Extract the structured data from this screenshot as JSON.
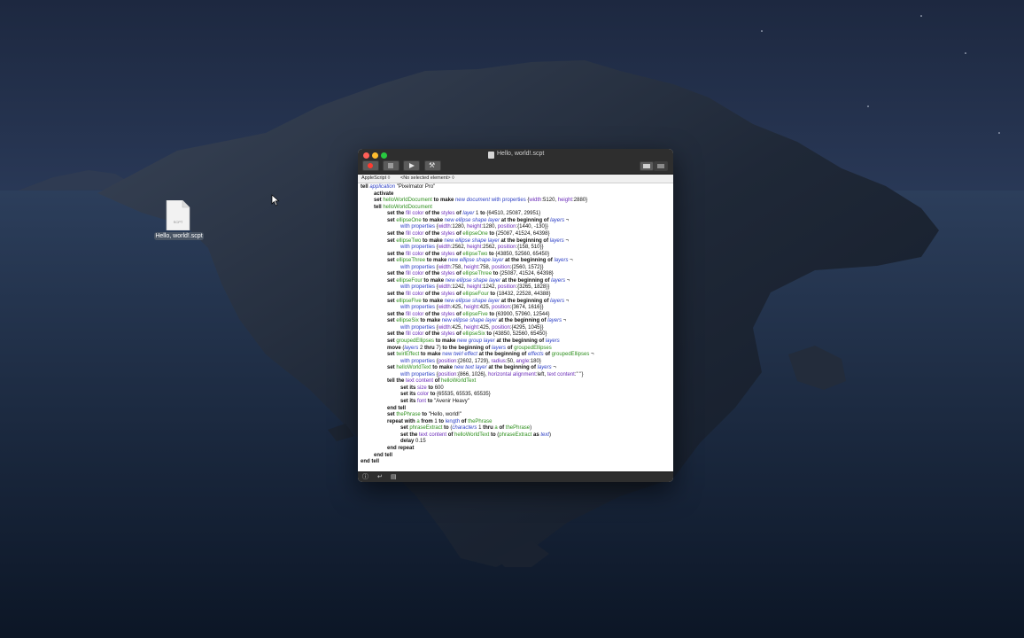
{
  "desktop": {
    "file_label": "Hello, world!.scpt",
    "file_kind": "SCPT"
  },
  "window": {
    "title": "Hello, world!.scpt",
    "language": "AppleScript ◊",
    "element_selector": "<No selected element> ◊",
    "toolbar": {
      "record": "record-icon",
      "stop": "stop-icon",
      "run": "play-icon",
      "compile": "hammer-icon"
    },
    "status_icons": [
      "ⓘ",
      "↵",
      "▤"
    ]
  },
  "colors": {
    "keyword": "#111111",
    "application_class": "#2b3ec4",
    "property": "#6a2bb8",
    "variable": "#2e8f1d",
    "record_button": "#ff3b30"
  },
  "code": [
    {
      "indent": 0,
      "tokens": [
        [
          "kw",
          "tell "
        ],
        [
          "app",
          "application "
        ],
        [
          "txt",
          "\"Pixelmator Pro\""
        ]
      ]
    },
    {
      "indent": 1,
      "tokens": [
        [
          "kw",
          "activate"
        ]
      ]
    },
    {
      "indent": 1,
      "tokens": [
        [
          "kw",
          "set "
        ],
        [
          "var",
          "helloWorldDocument"
        ],
        [
          "kw",
          " to "
        ],
        [
          "kw",
          "make "
        ],
        [
          "ver",
          "new "
        ],
        [
          "cls",
          "document "
        ],
        [
          "ver",
          "with properties "
        ],
        [
          "txt",
          "{"
        ],
        [
          "prop",
          "width"
        ],
        [
          "txt",
          ":5120, "
        ],
        [
          "prop",
          "height"
        ],
        [
          "txt",
          ":2880}"
        ]
      ]
    },
    {
      "indent": 1,
      "tokens": [
        [
          "kw",
          "tell "
        ],
        [
          "var",
          "helloWorldDocument"
        ]
      ]
    },
    {
      "indent": 2,
      "tokens": [
        [
          "kw",
          "set the "
        ],
        [
          "prop",
          "fill color"
        ],
        [
          "kw",
          " of the "
        ],
        [
          "prop",
          "styles"
        ],
        [
          "kw",
          " of "
        ],
        [
          "cls",
          "layer "
        ],
        [
          "txt",
          "1 "
        ],
        [
          "kw",
          "to "
        ],
        [
          "txt",
          "{64510, 25087, 29951}"
        ]
      ]
    },
    {
      "indent": 2,
      "tokens": [
        [
          "kw",
          "set "
        ],
        [
          "var",
          "ellipseOne"
        ],
        [
          "kw",
          " to "
        ],
        [
          "kw",
          "make "
        ],
        [
          "ver",
          "new "
        ],
        [
          "cls",
          "ellipse shape layer "
        ],
        [
          "kw",
          "at the beginning of "
        ],
        [
          "cls",
          "layers "
        ],
        [
          "txt",
          "¬"
        ]
      ]
    },
    {
      "indent": 3,
      "tokens": [
        [
          "ver",
          "with properties "
        ],
        [
          "txt",
          "{"
        ],
        [
          "prop",
          "width"
        ],
        [
          "txt",
          ":1280, "
        ],
        [
          "prop",
          "height"
        ],
        [
          "txt",
          ":1280, "
        ],
        [
          "prop",
          "position"
        ],
        [
          "txt",
          ":{1440, -130}}"
        ]
      ]
    },
    {
      "indent": 2,
      "tokens": [
        [
          "kw",
          "set the "
        ],
        [
          "prop",
          "fill color"
        ],
        [
          "kw",
          " of the "
        ],
        [
          "prop",
          "styles"
        ],
        [
          "kw",
          " of "
        ],
        [
          "var",
          "ellipseOne"
        ],
        [
          "kw",
          " to "
        ],
        [
          "txt",
          "{25087, 41524, 64398}"
        ]
      ]
    },
    {
      "indent": 2,
      "tokens": [
        [
          "kw",
          "set "
        ],
        [
          "var",
          "ellipseTwo"
        ],
        [
          "kw",
          " to "
        ],
        [
          "kw",
          "make "
        ],
        [
          "ver",
          "new "
        ],
        [
          "cls",
          "ellipse shape layer "
        ],
        [
          "kw",
          "at the beginning of "
        ],
        [
          "cls",
          "layers "
        ],
        [
          "txt",
          "¬"
        ]
      ]
    },
    {
      "indent": 3,
      "tokens": [
        [
          "ver",
          "with properties "
        ],
        [
          "txt",
          "{"
        ],
        [
          "prop",
          "width"
        ],
        [
          "txt",
          ":2562, "
        ],
        [
          "prop",
          "height"
        ],
        [
          "txt",
          ":2562, "
        ],
        [
          "prop",
          "position"
        ],
        [
          "txt",
          ":{158, 510}}"
        ]
      ]
    },
    {
      "indent": 2,
      "tokens": [
        [
          "kw",
          "set the "
        ],
        [
          "prop",
          "fill color"
        ],
        [
          "kw",
          " of the "
        ],
        [
          "prop",
          "styles"
        ],
        [
          "kw",
          " of "
        ],
        [
          "var",
          "ellipseTwo"
        ],
        [
          "kw",
          " to "
        ],
        [
          "txt",
          "{43850, 52560, 65450}"
        ]
      ]
    },
    {
      "indent": 2,
      "tokens": [
        [
          "kw",
          "set "
        ],
        [
          "var",
          "ellipseThree"
        ],
        [
          "kw",
          " to "
        ],
        [
          "kw",
          "make "
        ],
        [
          "ver",
          "new "
        ],
        [
          "cls",
          "ellipse shape layer "
        ],
        [
          "kw",
          "at the beginning of "
        ],
        [
          "cls",
          "layers "
        ],
        [
          "txt",
          "¬"
        ]
      ]
    },
    {
      "indent": 3,
      "tokens": [
        [
          "ver",
          "with properties "
        ],
        [
          "txt",
          "{"
        ],
        [
          "prop",
          "width"
        ],
        [
          "txt",
          ":758, "
        ],
        [
          "prop",
          "height"
        ],
        [
          "txt",
          ":758, "
        ],
        [
          "prop",
          "position"
        ],
        [
          "txt",
          ":{2560, 1572}}"
        ]
      ]
    },
    {
      "indent": 2,
      "tokens": [
        [
          "kw",
          "set the "
        ],
        [
          "prop",
          "fill color"
        ],
        [
          "kw",
          " of the "
        ],
        [
          "prop",
          "styles"
        ],
        [
          "kw",
          " of "
        ],
        [
          "var",
          "ellipseThree"
        ],
        [
          "kw",
          " to "
        ],
        [
          "txt",
          "{25087, 41524, 64398}"
        ]
      ]
    },
    {
      "indent": 2,
      "tokens": [
        [
          "kw",
          "set "
        ],
        [
          "var",
          "ellipseFour"
        ],
        [
          "kw",
          " to "
        ],
        [
          "kw",
          "make "
        ],
        [
          "ver",
          "new "
        ],
        [
          "cls",
          "ellipse shape layer "
        ],
        [
          "kw",
          "at the beginning of "
        ],
        [
          "cls",
          "layers "
        ],
        [
          "txt",
          "¬"
        ]
      ]
    },
    {
      "indent": 3,
      "tokens": [
        [
          "ver",
          "with properties "
        ],
        [
          "txt",
          "{"
        ],
        [
          "prop",
          "width"
        ],
        [
          "txt",
          ":1242, "
        ],
        [
          "prop",
          "height"
        ],
        [
          "txt",
          ":1242, "
        ],
        [
          "prop",
          "position"
        ],
        [
          "txt",
          ":{3265, 1828}}"
        ]
      ]
    },
    {
      "indent": 2,
      "tokens": [
        [
          "kw",
          "set the "
        ],
        [
          "prop",
          "fill color"
        ],
        [
          "kw",
          " of the "
        ],
        [
          "prop",
          "styles"
        ],
        [
          "kw",
          " of "
        ],
        [
          "var",
          "ellipseFour"
        ],
        [
          "kw",
          " to "
        ],
        [
          "txt",
          "{18432, 22528, 44388}"
        ]
      ]
    },
    {
      "indent": 2,
      "tokens": [
        [
          "kw",
          "set "
        ],
        [
          "var",
          "ellipseFive"
        ],
        [
          "kw",
          " to "
        ],
        [
          "kw",
          "make "
        ],
        [
          "ver",
          "new "
        ],
        [
          "cls",
          "ellipse shape layer "
        ],
        [
          "kw",
          "at the beginning of "
        ],
        [
          "cls",
          "layers "
        ],
        [
          "txt",
          "¬"
        ]
      ]
    },
    {
      "indent": 3,
      "tokens": [
        [
          "ver",
          "with properties "
        ],
        [
          "txt",
          "{"
        ],
        [
          "prop",
          "width"
        ],
        [
          "txt",
          ":425, "
        ],
        [
          "prop",
          "height"
        ],
        [
          "txt",
          ":425, "
        ],
        [
          "prop",
          "position"
        ],
        [
          "txt",
          ":{3674, 1616}}"
        ]
      ]
    },
    {
      "indent": 2,
      "tokens": [
        [
          "kw",
          "set the "
        ],
        [
          "prop",
          "fill color"
        ],
        [
          "kw",
          " of the "
        ],
        [
          "prop",
          "styles"
        ],
        [
          "kw",
          " of "
        ],
        [
          "var",
          "ellipseFive"
        ],
        [
          "kw",
          " to "
        ],
        [
          "txt",
          "{63900, 57960, 12544}"
        ]
      ]
    },
    {
      "indent": 2,
      "tokens": [
        [
          "kw",
          "set "
        ],
        [
          "var",
          "ellipseSix"
        ],
        [
          "kw",
          " to "
        ],
        [
          "kw",
          "make "
        ],
        [
          "ver",
          "new "
        ],
        [
          "cls",
          "ellipse shape layer "
        ],
        [
          "kw",
          "at the beginning of "
        ],
        [
          "cls",
          "layers "
        ],
        [
          "txt",
          "¬"
        ]
      ]
    },
    {
      "indent": 3,
      "tokens": [
        [
          "ver",
          "with properties "
        ],
        [
          "txt",
          "{"
        ],
        [
          "prop",
          "width"
        ],
        [
          "txt",
          ":425, "
        ],
        [
          "prop",
          "height"
        ],
        [
          "txt",
          ":425, "
        ],
        [
          "prop",
          "position"
        ],
        [
          "txt",
          ":{4295, 1045}}"
        ]
      ]
    },
    {
      "indent": 2,
      "tokens": [
        [
          "kw",
          "set the "
        ],
        [
          "prop",
          "fill color"
        ],
        [
          "kw",
          " of the "
        ],
        [
          "prop",
          "styles"
        ],
        [
          "kw",
          " of "
        ],
        [
          "var",
          "ellipseSix"
        ],
        [
          "kw",
          " to "
        ],
        [
          "txt",
          "{43850, 52560, 65450}"
        ]
      ]
    },
    {
      "indent": 2,
      "tokens": [
        [
          "kw",
          "set "
        ],
        [
          "var",
          "groupedEllipses"
        ],
        [
          "kw",
          " to "
        ],
        [
          "kw",
          "make "
        ],
        [
          "ver",
          "new "
        ],
        [
          "cls",
          "group layer "
        ],
        [
          "kw",
          "at the beginning of "
        ],
        [
          "cls",
          "layers"
        ]
      ]
    },
    {
      "indent": 2,
      "tokens": [
        [
          "kw",
          "move "
        ],
        [
          "txt",
          "("
        ],
        [
          "cls",
          "layers "
        ],
        [
          "txt",
          "2 "
        ],
        [
          "kw",
          "thru "
        ],
        [
          "txt",
          "7) "
        ],
        [
          "kw",
          "to the beginning of "
        ],
        [
          "cls",
          "layers "
        ],
        [
          "kw",
          "of "
        ],
        [
          "var",
          "groupedEllipses"
        ]
      ]
    },
    {
      "indent": 2,
      "tokens": [
        [
          "kw",
          "set "
        ],
        [
          "var",
          "twirlEffect"
        ],
        [
          "kw",
          " to "
        ],
        [
          "kw",
          "make "
        ],
        [
          "ver",
          "new "
        ],
        [
          "cls",
          "twirl effect "
        ],
        [
          "kw",
          "at the beginning of "
        ],
        [
          "cls",
          "effects "
        ],
        [
          "kw",
          "of "
        ],
        [
          "var",
          "groupedEllipses "
        ],
        [
          "txt",
          "¬"
        ]
      ]
    },
    {
      "indent": 3,
      "tokens": [
        [
          "ver",
          "with properties "
        ],
        [
          "txt",
          "{"
        ],
        [
          "prop",
          "position"
        ],
        [
          "txt",
          ":{2602, 1729}, "
        ],
        [
          "prop",
          "radius"
        ],
        [
          "txt",
          ":50, "
        ],
        [
          "prop",
          "angle"
        ],
        [
          "txt",
          ":180}"
        ]
      ]
    },
    {
      "indent": 2,
      "tokens": [
        [
          "kw",
          "set "
        ],
        [
          "var",
          "helloWorldText"
        ],
        [
          "kw",
          " to "
        ],
        [
          "kw",
          "make "
        ],
        [
          "ver",
          "new "
        ],
        [
          "cls",
          "text layer "
        ],
        [
          "kw",
          "at the beginning of "
        ],
        [
          "cls",
          "layers "
        ],
        [
          "txt",
          "¬"
        ]
      ]
    },
    {
      "indent": 3,
      "tokens": [
        [
          "ver",
          "with properties "
        ],
        [
          "txt",
          "{"
        ],
        [
          "prop",
          "position"
        ],
        [
          "txt",
          ":{866, 1026}, "
        ],
        [
          "prop",
          "horizontal alignment"
        ],
        [
          "txt",
          ":left, "
        ],
        [
          "prop",
          "text content"
        ],
        [
          "txt",
          ":\" \"}"
        ]
      ]
    },
    {
      "indent": 2,
      "tokens": [
        [
          "kw",
          "tell the "
        ],
        [
          "prop",
          "text content"
        ],
        [
          "kw",
          " of "
        ],
        [
          "var",
          "helloWorldText"
        ]
      ]
    },
    {
      "indent": 3,
      "tokens": [
        [
          "kw",
          "set its "
        ],
        [
          "prop",
          "size"
        ],
        [
          "kw",
          " to "
        ],
        [
          "txt",
          "600"
        ]
      ]
    },
    {
      "indent": 3,
      "tokens": [
        [
          "kw",
          "set its "
        ],
        [
          "prop",
          "color"
        ],
        [
          "kw",
          " to "
        ],
        [
          "txt",
          "{65535, 65535, 65535}"
        ]
      ]
    },
    {
      "indent": 3,
      "tokens": [
        [
          "kw",
          "set its "
        ],
        [
          "prop",
          "font"
        ],
        [
          "kw",
          " to "
        ],
        [
          "txt",
          "\"Avenir Heavy\""
        ]
      ]
    },
    {
      "indent": 2,
      "tokens": [
        [
          "kw",
          "end tell"
        ]
      ]
    },
    {
      "indent": 2,
      "tokens": [
        [
          "kw",
          "set "
        ],
        [
          "var",
          "thePhrase"
        ],
        [
          "kw",
          " to "
        ],
        [
          "txt",
          "\"Hello, world!\""
        ]
      ]
    },
    {
      "indent": 2,
      "tokens": [
        [
          "kw",
          "repeat with "
        ],
        [
          "var",
          "a"
        ],
        [
          "kw",
          " from "
        ],
        [
          "txt",
          "1 "
        ],
        [
          "kw",
          "to "
        ],
        [
          "ver",
          "length "
        ],
        [
          "kw",
          "of "
        ],
        [
          "var",
          "thePhrase"
        ]
      ]
    },
    {
      "indent": 3,
      "tokens": [
        [
          "kw",
          "set "
        ],
        [
          "var",
          "phraseExtract"
        ],
        [
          "kw",
          " to "
        ],
        [
          "txt",
          "("
        ],
        [
          "cls",
          "characters "
        ],
        [
          "txt",
          "1 "
        ],
        [
          "kw",
          "thru "
        ],
        [
          "var",
          "a "
        ],
        [
          "kw",
          "of "
        ],
        [
          "var",
          "thePhrase"
        ],
        [
          "txt",
          ")"
        ]
      ]
    },
    {
      "indent": 3,
      "tokens": [
        [
          "kw",
          "set the "
        ],
        [
          "prop",
          "text content"
        ],
        [
          "kw",
          " of "
        ],
        [
          "var",
          "helloWorldText"
        ],
        [
          "kw",
          " to "
        ],
        [
          "txt",
          "("
        ],
        [
          "var",
          "phraseExtract "
        ],
        [
          "kw",
          "as "
        ],
        [
          "cls",
          "text"
        ],
        [
          "txt",
          ")"
        ]
      ]
    },
    {
      "indent": 3,
      "tokens": [
        [
          "kw",
          "delay "
        ],
        [
          "txt",
          "0.15"
        ]
      ]
    },
    {
      "indent": 2,
      "tokens": [
        [
          "kw",
          "end repeat"
        ]
      ]
    },
    {
      "indent": 1,
      "tokens": [
        [
          "kw",
          "end tell"
        ]
      ]
    },
    {
      "indent": 0,
      "tokens": [
        [
          "kw",
          "end tell"
        ]
      ]
    }
  ]
}
